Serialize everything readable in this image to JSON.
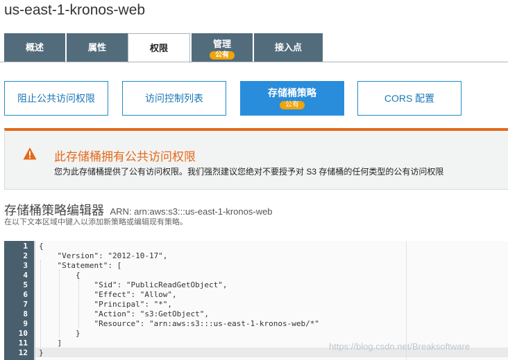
{
  "bucket": {
    "name": "us-east-1-kronos-web"
  },
  "tabs": [
    {
      "label": "概述"
    },
    {
      "label": "属性"
    },
    {
      "label": "权限"
    },
    {
      "label": "管理",
      "badge": "公有"
    },
    {
      "label": "接入点"
    }
  ],
  "subtabs": [
    {
      "label": "阻止公共访问权限"
    },
    {
      "label": "访问控制列表"
    },
    {
      "label": "存储桶策略",
      "badge": "公有"
    },
    {
      "label": "CORS 配置"
    }
  ],
  "alert": {
    "icon": "warning-icon",
    "title": "此存储桶拥有公共访问权限",
    "body": "您为此存储桶提供了公有访问权限。我们强烈建议您绝对不要授予对 S3 存储桶的任何类型的公有访问权限"
  },
  "editor": {
    "heading": "存储桶策略编辑器",
    "arn": "ARN: arn:aws:s3:::us-east-1-kronos-web",
    "hint": "在以下文本区域中键入以添加新策略或编辑现有策略。",
    "lines": [
      "{",
      "    \"Version\": \"2012-10-17\",",
      "    \"Statement\": [",
      "        {",
      "            \"Sid\": \"PublicReadGetObject\",",
      "            \"Effect\": \"Allow\",",
      "            \"Principal\": \"*\",",
      "            \"Action\": \"s3:GetObject\",",
      "            \"Resource\": \"arn:aws:s3:::us-east-1-kronos-web/*\"",
      "        }",
      "    ]",
      "}"
    ],
    "line_numbers": [
      "1",
      "2",
      "3",
      "4",
      "5",
      "6",
      "7",
      "8",
      "9",
      "10",
      "11",
      "12"
    ]
  },
  "watermark": "https://blog.csdn.net/Breaksoftware",
  "colors": {
    "tab_bg": "#536c7c",
    "accent_blue": "#2a8ddb",
    "badge": "#f0a30a",
    "warning": "#e46a1a"
  }
}
